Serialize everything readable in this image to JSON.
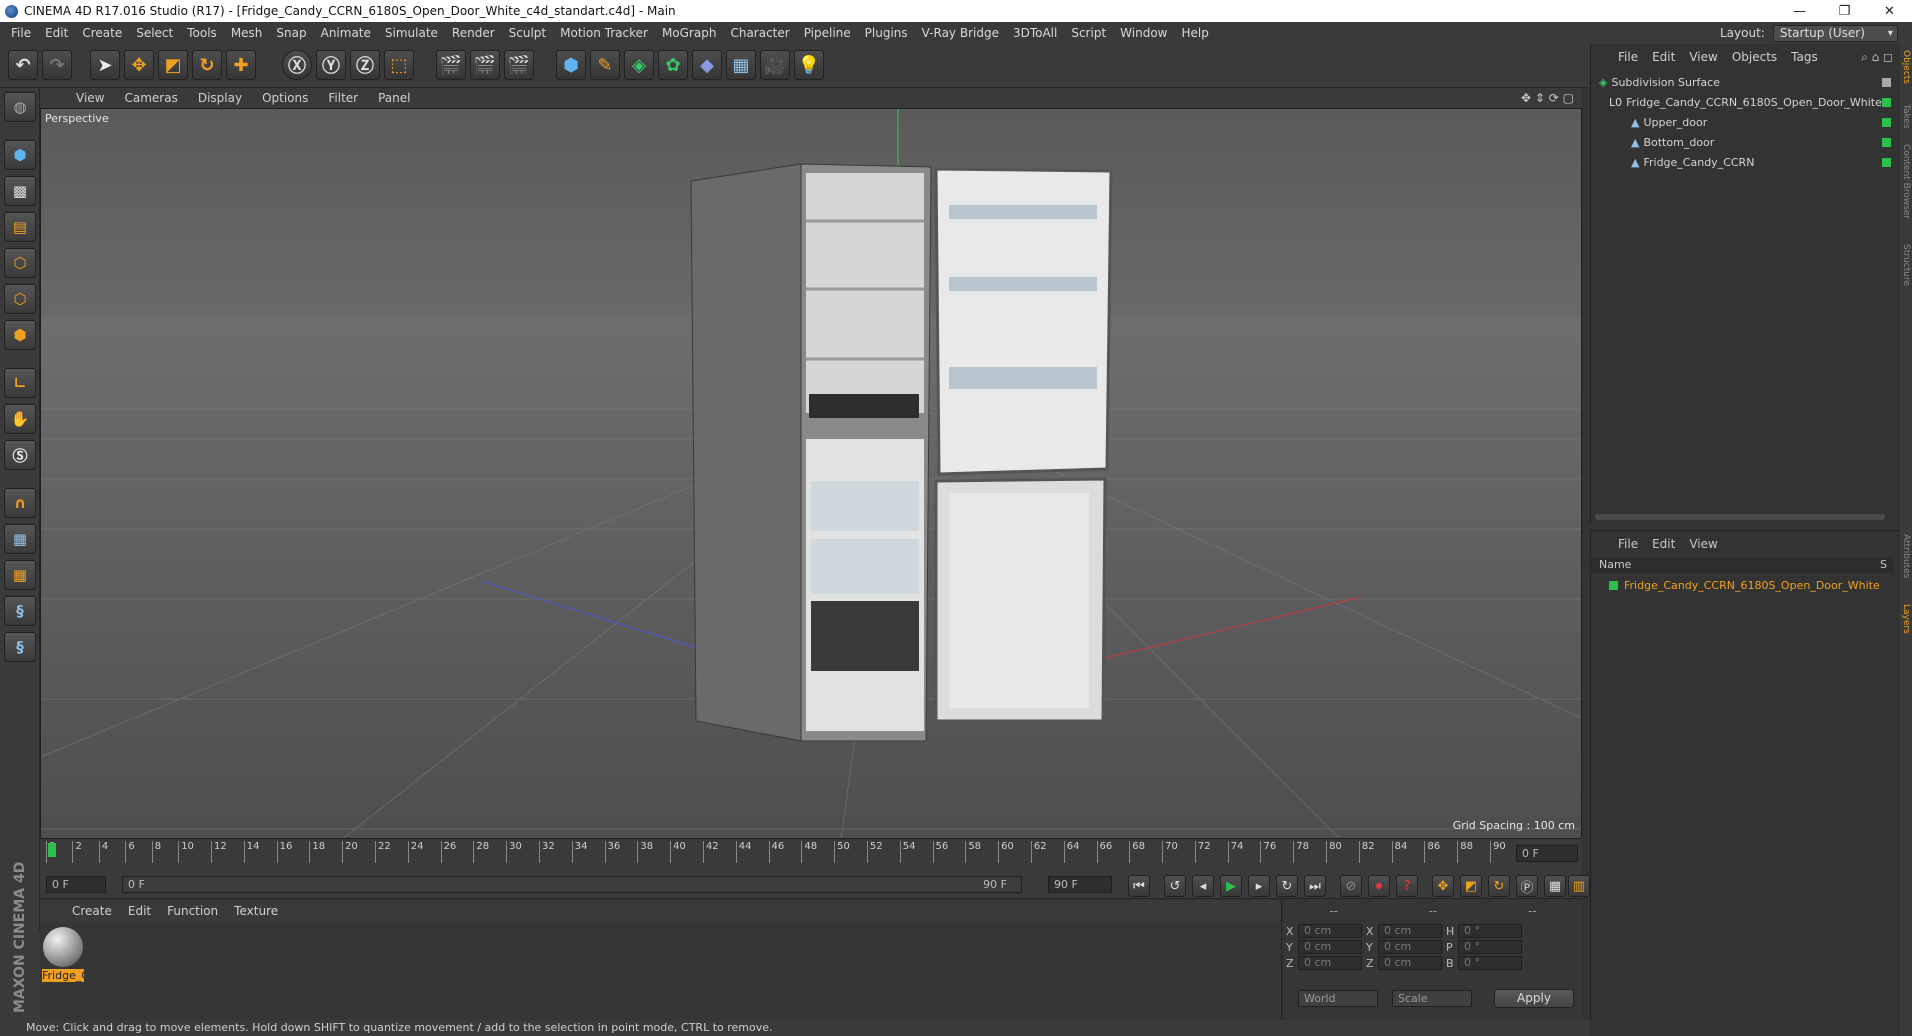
{
  "window": {
    "title": "CINEMA 4D R17.016 Studio (R17) - [Fridge_Candy_CCRN_6180S_Open_Door_White_c4d_standart.c4d] - Main",
    "controls": [
      "—",
      "❐",
      "✕"
    ]
  },
  "menubar": [
    "File",
    "Edit",
    "Create",
    "Select",
    "Tools",
    "Mesh",
    "Snap",
    "Animate",
    "Simulate",
    "Render",
    "Sculpt",
    "Motion Tracker",
    "MoGraph",
    "Character",
    "Pipeline",
    "Plugins",
    "V-Ray Bridge",
    "3DToAll",
    "Script",
    "Window",
    "Help"
  ],
  "layout": {
    "label": "Layout:",
    "value": "Startup (User)"
  },
  "viewport": {
    "menu": [
      "View",
      "Cameras",
      "Display",
      "Options",
      "Filter",
      "Panel"
    ],
    "label": "Perspective",
    "grid_spacing": "Grid Spacing : 100 cm",
    "colors": {
      "x_axis": "#c63b3b",
      "y_axis": "#3ec43e",
      "z_axis": "#4a5ad6"
    }
  },
  "timeline": {
    "ticks": [
      "0",
      "2",
      "4",
      "6",
      "8",
      "10",
      "12",
      "14",
      "16",
      "18",
      "20",
      "22",
      "24",
      "26",
      "28",
      "30",
      "32",
      "34",
      "36",
      "38",
      "40",
      "42",
      "44",
      "46",
      "48",
      "50",
      "52",
      "54",
      "56",
      "58",
      "60",
      "62",
      "64",
      "66",
      "68",
      "70",
      "72",
      "74",
      "76",
      "78",
      "80",
      "82",
      "84",
      "86",
      "88",
      "90"
    ],
    "current_frame": "0 F"
  },
  "playbar": {
    "start": "0 F",
    "range_start": "0 F",
    "range_end": "90 F",
    "end": "90 F"
  },
  "materials": {
    "menu": [
      "Create",
      "Edit",
      "Function",
      "Texture"
    ],
    "items": [
      {
        "name": "Fridge_C"
      }
    ]
  },
  "coordinates": {
    "headers": [
      "--",
      "--",
      "--"
    ],
    "rows": [
      {
        "a": "X",
        "av": "0 cm",
        "b": "X",
        "bv": "0 cm",
        "c": "H",
        "cv": "0 °"
      },
      {
        "a": "Y",
        "av": "0 cm",
        "b": "Y",
        "bv": "0 cm",
        "c": "P",
        "cv": "0 °"
      },
      {
        "a": "Z",
        "av": "0 cm",
        "b": "Z",
        "bv": "0 cm",
        "c": "B",
        "cv": "0 °"
      }
    ],
    "mode": "World",
    "transform": "Scale",
    "apply": "Apply"
  },
  "object_manager": {
    "menu": [
      "File",
      "Edit",
      "View",
      "Objects",
      "Tags"
    ],
    "items": [
      {
        "name": "Subdivision Surface"
      },
      {
        "name": "Fridge_Candy_CCRN_6180S_Open_Door_White"
      },
      {
        "name": "Upper_door"
      },
      {
        "name": "Bottom_door"
      },
      {
        "name": "Fridge_Candy_CCRN"
      }
    ]
  },
  "attribute_manager": {
    "menu": [
      "File",
      "Edit",
      "View"
    ],
    "column_name": "Name",
    "column_s": "S",
    "items": [
      {
        "name": "Fridge_Candy_CCRN_6180S_Open_Door_White",
        "color": "#f0a020"
      }
    ]
  },
  "side_tabs": [
    "Objects",
    "Takes",
    "Content Browser",
    "Structure",
    "Attributes",
    "Layers"
  ],
  "maxon": "MAXON CINEMA 4D",
  "status": "Move: Click and drag to move elements. Hold down SHIFT to quantize movement / add to the selection in point mode, CTRL to remove."
}
